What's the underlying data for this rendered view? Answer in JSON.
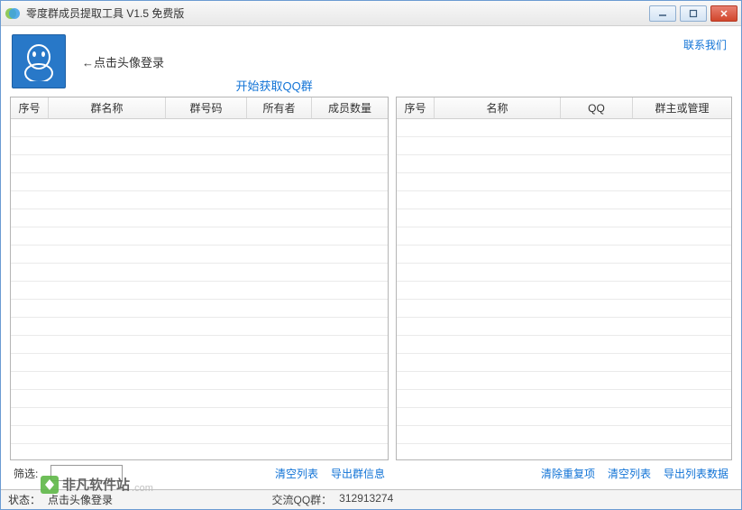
{
  "titlebar": {
    "title": "零度群成员提取工具 V1.5 免费版"
  },
  "top": {
    "login_hint": "←点击头像登录",
    "contact_us": "联系我们",
    "start_fetch": "开始获取QQ群"
  },
  "left_table": {
    "headers": [
      "序号",
      "群名称",
      "群号码",
      "所有者",
      "成员数量"
    ]
  },
  "right_table": {
    "headers": [
      "序号",
      "名称",
      "QQ",
      "群主或管理"
    ]
  },
  "left_footer": {
    "filter_label": "筛选:",
    "filter_value": "",
    "clear_list": "清空列表",
    "export_group": "导出群信息"
  },
  "right_footer": {
    "remove_dup": "清除重复项",
    "clear_list": "清空列表",
    "export_list": "导出列表数据"
  },
  "statusbar": {
    "status_label": "状态：",
    "status_text": "点击头像登录",
    "qq_group_label": "交流QQ群：",
    "qq_group_number": "312913274"
  },
  "watermark": {
    "text": "非凡软件站",
    "sub": ".com"
  }
}
